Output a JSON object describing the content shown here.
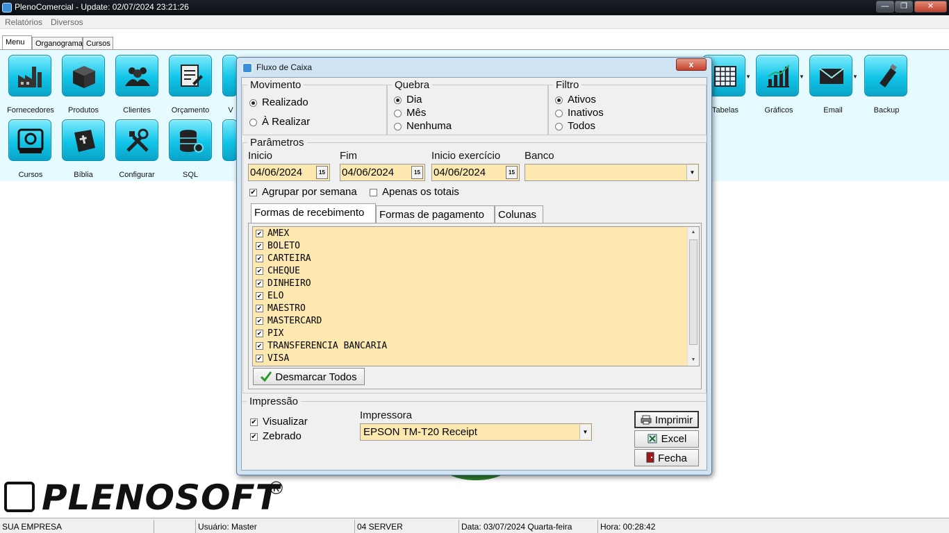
{
  "window": {
    "title": "PlenoComercial - Update: 02/07/2024 23:21:26",
    "min_label": "—",
    "max_label": "❐",
    "close_label": "✕"
  },
  "menubar": [
    "Relatórios",
    "Diversos"
  ],
  "main_tabs": [
    "Menu",
    "Organograma",
    "Cursos"
  ],
  "ribbon": {
    "row1": [
      {
        "label": "Fornecedores",
        "icon": "factory-icon"
      },
      {
        "label": "Produtos",
        "icon": "box-icon"
      },
      {
        "label": "Clientes",
        "icon": "people-icon"
      },
      {
        "label": "Orçamento",
        "icon": "document-pen-icon"
      },
      {
        "label": "V",
        "icon": "cart-icon"
      },
      {
        "label": "Tabelas",
        "icon": "calendar-table-icon"
      },
      {
        "label": "Gráficos",
        "icon": "bar-chart-icon"
      },
      {
        "label": "Email",
        "icon": "envelope-icon"
      },
      {
        "label": "Backup",
        "icon": "usb-drive-icon"
      }
    ],
    "row2": [
      {
        "label": "Cursos",
        "icon": "plenosoft-logo-icon"
      },
      {
        "label": "Bíblia",
        "icon": "bible-icon"
      },
      {
        "label": "Configurar",
        "icon": "tools-icon"
      },
      {
        "label": "SQL",
        "icon": "database-gear-icon"
      }
    ]
  },
  "brand": {
    "logo_text": "PLENOSOFT",
    "registered": "®"
  },
  "statusbar": {
    "company": "SUA EMPRESA",
    "blank": "",
    "user": "Usuário: Master",
    "server": "04 SERVER",
    "date": "Data: 03/07/2024 Quarta-feira",
    "time": "Hora: 00:28:42"
  },
  "dialog": {
    "title": "Fluxo de Caixa",
    "close_label": "x",
    "movimento": {
      "legend": "Movimento",
      "options": [
        "Realizado",
        "À Realizar"
      ],
      "selected": "Realizado"
    },
    "quebra": {
      "legend": "Quebra",
      "options": [
        "Dia",
        "Mês",
        "Nenhuma"
      ],
      "selected": "Dia"
    },
    "filtro": {
      "legend": "Filtro",
      "options": [
        "Ativos",
        "Inativos",
        "Todos"
      ],
      "selected": "Ativos"
    },
    "parametros": {
      "legend": "Parâmetros",
      "inicio_label": "Inicio",
      "inicio_value": "04/06/2024",
      "fim_label": "Fim",
      "fim_value": "04/06/2024",
      "inicio_exercicio_label": "Inicio exercício",
      "inicio_exercicio_value": "04/06/2024",
      "banco_label": "Banco",
      "banco_value": "",
      "calendar_glyph": "15",
      "agrupar_label": "Agrupar por semana",
      "agrupar_checked": true,
      "apenas_totais_label": "Apenas os totais",
      "apenas_totais_checked": false
    },
    "tabs": [
      "Formas de recebimento",
      "Formas de pagamento",
      "Colunas"
    ],
    "active_tab": "Formas de recebimento",
    "formas": [
      "AMEX",
      "BOLETO",
      "CARTEIRA",
      "CHEQUE",
      "DINHEIRO",
      "ELO",
      "MAESTRO",
      "MASTERCARD",
      "PIX",
      "TRANSFERENCIA BANCARIA",
      "VISA"
    ],
    "check_glyph": "✔",
    "desmarcar_label": "Desmarcar Todos",
    "impressao": {
      "legend": "Impressão",
      "visualizar_label": "Visualizar",
      "visualizar_checked": true,
      "zebrado_label": "Zebrado",
      "zebrado_checked": true,
      "impressora_label": "Impressora",
      "impressora_value": "EPSON TM-T20 Receipt"
    },
    "buttons": {
      "imprimir": "Imprimir",
      "excel": "Excel",
      "fecha": "Fecha"
    }
  }
}
